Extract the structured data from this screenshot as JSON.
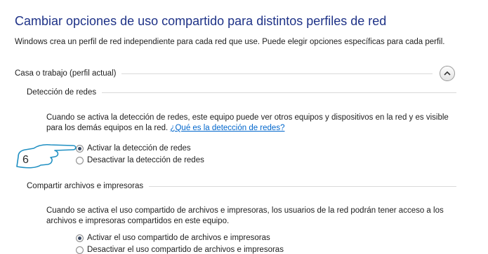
{
  "page": {
    "title": "Cambiar opciones de uso compartido para distintos perfiles de red",
    "description": "Windows crea un perfil de red independiente para cada red que use. Puede elegir opciones específicas para cada perfil."
  },
  "profile": {
    "label": "Casa o trabajo (perfil actual)",
    "collapse_icon": "chevron-up-icon"
  },
  "network_discovery": {
    "heading": "Detección de redes",
    "body_text": "Cuando se activa la detección de redes, este equipo puede ver otros equipos y dispositivos en la red y es visible para los demás equipos en la red. ",
    "help_link": "¿Qué es la detección de redes?",
    "options": [
      {
        "label": "Activar la detección de redes",
        "checked": true
      },
      {
        "label": "Desactivar la detección de redes",
        "checked": false
      }
    ]
  },
  "file_sharing": {
    "heading": "Compartir archivos e impresoras",
    "body_text": "Cuando se activa el uso compartido de archivos e impresoras, los usuarios de la red podrán tener acceso a los archivos e impresoras compartidos en este equipo.",
    "options": [
      {
        "label": "Activar el uso compartido de archivos e impresoras",
        "checked": true
      },
      {
        "label": "Desactivar el uso compartido de archivos e impresoras",
        "checked": false
      }
    ]
  },
  "annotation": {
    "number": "6",
    "color": "#1f8fc2"
  }
}
